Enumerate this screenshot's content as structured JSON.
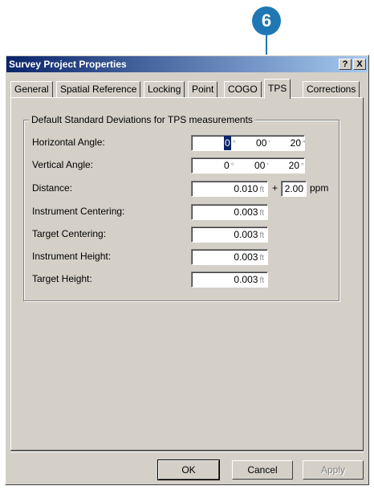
{
  "callout": {
    "number": "6"
  },
  "window": {
    "title": "Survey Project Properties",
    "help_label": "?",
    "close_label": "X"
  },
  "tabs": [
    {
      "label": "General"
    },
    {
      "label": "Spatial Reference"
    },
    {
      "label": "Locking"
    },
    {
      "label": "Point"
    },
    {
      "label": "COGO"
    },
    {
      "label": "TPS",
      "active": true
    },
    {
      "label": "Corrections"
    }
  ],
  "group": {
    "title": "Default Standard Deviations for TPS measurements",
    "fields": [
      {
        "label": "Horizontal Angle:",
        "deg": "0",
        "min": "00",
        "sec": "20",
        "deg_unit": "°",
        "min_unit": "'",
        "sec_unit": "\""
      },
      {
        "label": "Vertical Angle:",
        "deg": "0",
        "min": "00",
        "sec": "20",
        "deg_unit": "°",
        "min_unit": "'",
        "sec_unit": "\""
      },
      {
        "label": "Distance:",
        "value": "0.010",
        "unit": "ft",
        "plus": "+",
        "ppm_value": "2.00",
        "ppm_unit": "ppm"
      },
      {
        "label": "Instrument Centering:",
        "value": "0.003",
        "unit": "ft"
      },
      {
        "label": "Target Centering:",
        "value": "0.003",
        "unit": "ft"
      },
      {
        "label": "Instrument Height:",
        "value": "0.003",
        "unit": "ft"
      },
      {
        "label": "Target Height:",
        "value": "0.003",
        "unit": "ft"
      }
    ]
  },
  "buttons": {
    "ok": "OK",
    "cancel": "Cancel",
    "apply": "Apply"
  }
}
